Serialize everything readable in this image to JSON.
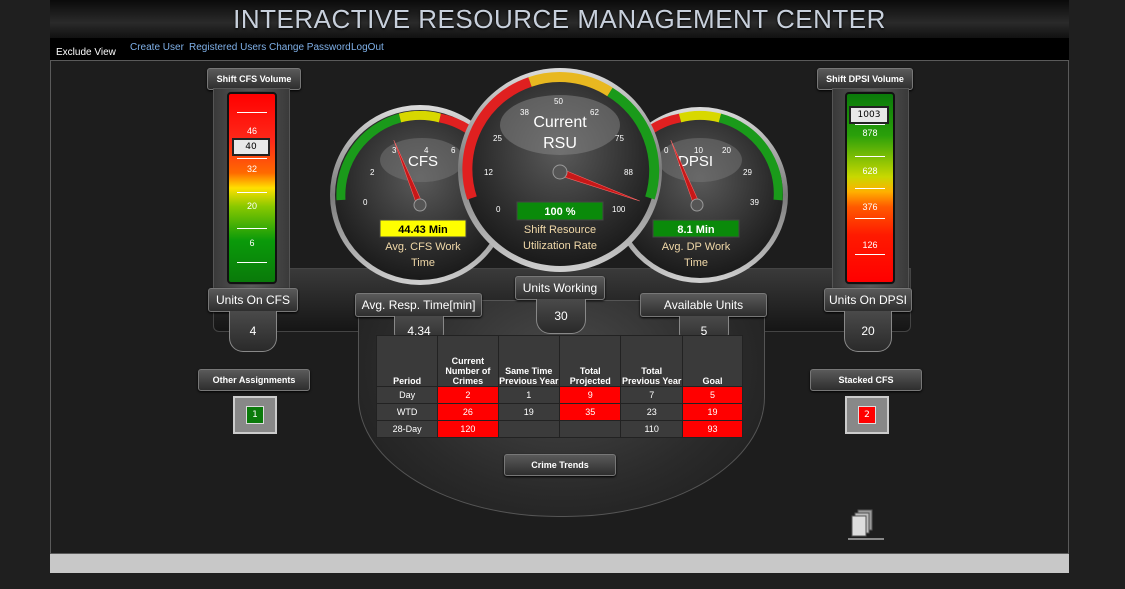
{
  "header": {
    "title": "INTERACTIVE RESOURCE MANAGEMENT CENTER"
  },
  "nav": {
    "exclude_view": "Exclude View",
    "links": [
      "Create User",
      "Registered Users",
      "Change Password",
      "LogOut"
    ]
  },
  "cfs_volume": {
    "label": "Shift CFS Volume",
    "scale": [
      "46",
      "32",
      "20",
      "6"
    ],
    "marker": "40"
  },
  "dpsi_volume": {
    "label": "Shift DPSI Volume",
    "scale": [
      "878",
      "628",
      "376",
      "126"
    ],
    "marker": "1003"
  },
  "gauge_cfs": {
    "title": "CFS",
    "ticks": [
      "0",
      "2",
      "3",
      "4",
      "6"
    ],
    "value": "44.43 Min",
    "caption_1": "Avg. CFS Work",
    "caption_2": "Time",
    "reading_fraction": 0.4
  },
  "gauge_rsu": {
    "title_1": "Current",
    "title_2": "RSU",
    "ticks": [
      "0",
      "12",
      "25",
      "38",
      "50",
      "62",
      "75",
      "88",
      "100"
    ],
    "value": "100 %",
    "caption_1": "Shift Resource",
    "caption_2": "Utilization Rate",
    "reading_fraction": 1.0
  },
  "gauge_dpsi": {
    "title": "DPSI",
    "ticks": [
      "0",
      "10",
      "20",
      "29",
      "39"
    ],
    "value": "8.1 Min",
    "caption_1": "Avg. DP Work",
    "caption_2": "Time",
    "reading_fraction": 0.4
  },
  "units_on_cfs": {
    "label": "Units On CFS",
    "value": "4"
  },
  "avg_resp": {
    "label": "Avg. Resp. Time[min]",
    "value": "4.34"
  },
  "units_working": {
    "label": "Units Working",
    "value": "30"
  },
  "available_units": {
    "label": "Available Units",
    "value": "5"
  },
  "units_on_dpsi": {
    "label": "Units On DPSI",
    "value": "20"
  },
  "other_assignments": {
    "label": "Other Assignments",
    "value": "1"
  },
  "stacked_cfs": {
    "label": "Stacked CFS",
    "value": "2"
  },
  "crime_table": {
    "headers": [
      "Period",
      "Current Number of Crimes",
      "Same Time Previous Year",
      "Total Projected",
      "Total Previous Year",
      "Goal"
    ],
    "rows": [
      {
        "cells": [
          "Day",
          "2",
          "1",
          "9",
          "7",
          "5"
        ],
        "red": [
          false,
          true,
          false,
          true,
          false,
          true
        ]
      },
      {
        "cells": [
          "WTD",
          "26",
          "19",
          "35",
          "23",
          "19"
        ],
        "red": [
          false,
          true,
          false,
          true,
          false,
          true
        ]
      },
      {
        "cells": [
          "28-Day",
          "120",
          "",
          "",
          "110",
          "93"
        ],
        "red": [
          false,
          true,
          false,
          false,
          false,
          true
        ]
      }
    ]
  },
  "crime_trends": {
    "label": "Crime Trends"
  },
  "colors": {
    "red": "#ff0000",
    "green": "#0a7a0a",
    "yellow": "#ffff00",
    "link": "#7fb0e8"
  }
}
